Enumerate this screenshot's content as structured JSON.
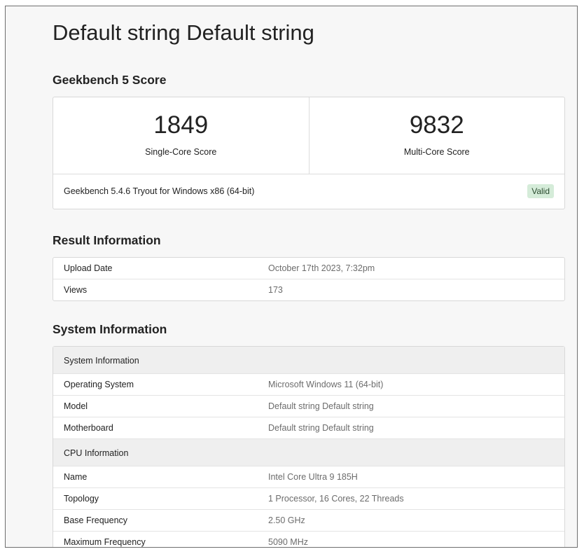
{
  "page": {
    "title": "Default string Default string"
  },
  "score": {
    "heading": "Geekbench 5 Score",
    "single_value": "1849",
    "single_label": "Single-Core Score",
    "multi_value": "9832",
    "multi_label": "Multi-Core Score",
    "version": "Geekbench 5.4.6 Tryout for Windows x86 (64-bit)",
    "badge": "Valid"
  },
  "result": {
    "heading": "Result Information",
    "rows": [
      {
        "key": "Upload Date",
        "value": "October 17th 2023, 7:32pm"
      },
      {
        "key": "Views",
        "value": "173"
      }
    ]
  },
  "system": {
    "heading": "System Information",
    "sections": [
      {
        "header": "System Information",
        "rows": [
          {
            "key": "Operating System",
            "value": "Microsoft Windows 11 (64-bit)"
          },
          {
            "key": "Model",
            "value": "Default string Default string"
          },
          {
            "key": "Motherboard",
            "value": "Default string Default string"
          }
        ]
      },
      {
        "header": "CPU Information",
        "rows": [
          {
            "key": "Name",
            "value": "Intel Core Ultra 9 185H"
          },
          {
            "key": "Topology",
            "value": "1 Processor, 16 Cores, 22 Threads"
          },
          {
            "key": "Base Frequency",
            "value": "2.50 GHz"
          },
          {
            "key": "Maximum Frequency",
            "value": "5090 MHz"
          }
        ]
      }
    ]
  },
  "colors": {
    "valid_badge_bg": "#d5ecd9",
    "section_header_bg": "#efefef",
    "page_bg": "#f7f7f7"
  }
}
